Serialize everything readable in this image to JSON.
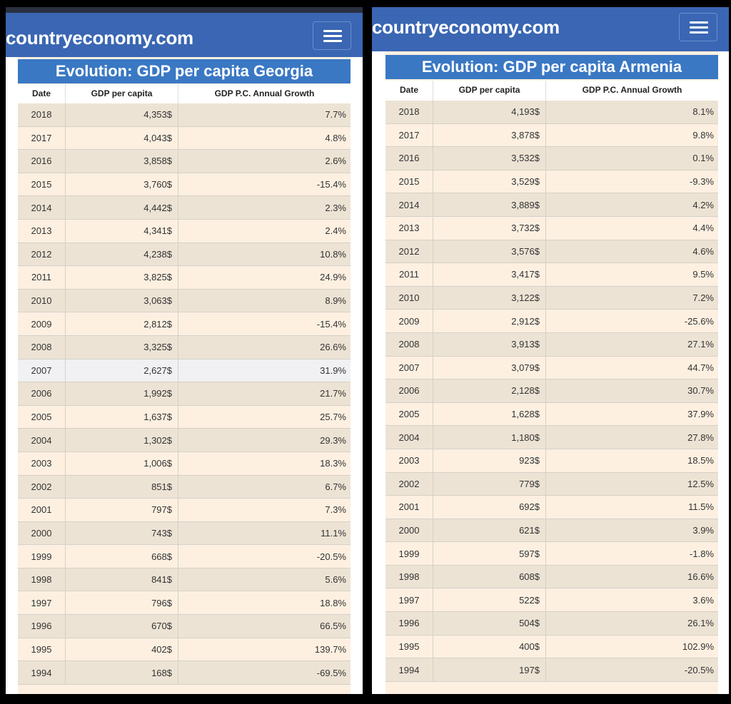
{
  "left": {
    "site_name": "countryeconomy.com",
    "table_title": "Evolution: GDP per capita Georgia",
    "headers": [
      "Date",
      "GDP per capita",
      "GDP P.C. Annual Growth"
    ],
    "rows": [
      [
        "2018",
        "4,353$",
        "7.7%"
      ],
      [
        "2017",
        "4,043$",
        "4.8%"
      ],
      [
        "2016",
        "3,858$",
        "2.6%"
      ],
      [
        "2015",
        "3,760$",
        "-15.4%"
      ],
      [
        "2014",
        "4,442$",
        "2.3%"
      ],
      [
        "2013",
        "4,341$",
        "2.4%"
      ],
      [
        "2012",
        "4,238$",
        "10.8%"
      ],
      [
        "2011",
        "3,825$",
        "24.9%"
      ],
      [
        "2010",
        "3,063$",
        "8.9%"
      ],
      [
        "2009",
        "2,812$",
        "-15.4%"
      ],
      [
        "2008",
        "3,325$",
        "26.6%"
      ],
      [
        "2007",
        "2,627$",
        "31.9%"
      ],
      [
        "2006",
        "1,992$",
        "21.7%"
      ],
      [
        "2005",
        "1,637$",
        "25.7%"
      ],
      [
        "2004",
        "1,302$",
        "29.3%"
      ],
      [
        "2003",
        "1,006$",
        "18.3%"
      ],
      [
        "2002",
        "851$",
        "6.7%"
      ],
      [
        "2001",
        "797$",
        "7.3%"
      ],
      [
        "2000",
        "743$",
        "11.1%"
      ],
      [
        "1999",
        "668$",
        "-20.5%"
      ],
      [
        "1998",
        "841$",
        "5.6%"
      ],
      [
        "1997",
        "796$",
        "18.8%"
      ],
      [
        "1996",
        "670$",
        "66.5%"
      ],
      [
        "1995",
        "402$",
        "139.7%"
      ],
      [
        "1994",
        "168$",
        "-69.5%"
      ]
    ]
  },
  "right": {
    "site_name": "countryeconomy.com",
    "table_title": "Evolution: GDP per capita Armenia",
    "headers": [
      "Date",
      "GDP per capita",
      "GDP P.C. Annual Growth"
    ],
    "rows": [
      [
        "2018",
        "4,193$",
        "8.1%"
      ],
      [
        "2017",
        "3,878$",
        "9.8%"
      ],
      [
        "2016",
        "3,532$",
        "0.1%"
      ],
      [
        "2015",
        "3,529$",
        "-9.3%"
      ],
      [
        "2014",
        "3,889$",
        "4.2%"
      ],
      [
        "2013",
        "3,732$",
        "4.4%"
      ],
      [
        "2012",
        "3,576$",
        "4.6%"
      ],
      [
        "2011",
        "3,417$",
        "9.5%"
      ],
      [
        "2010",
        "3,122$",
        "7.2%"
      ],
      [
        "2009",
        "2,912$",
        "-25.6%"
      ],
      [
        "2008",
        "3,913$",
        "27.1%"
      ],
      [
        "2007",
        "3,079$",
        "44.7%"
      ],
      [
        "2006",
        "2,128$",
        "30.7%"
      ],
      [
        "2005",
        "1,628$",
        "37.9%"
      ],
      [
        "2004",
        "1,180$",
        "27.8%"
      ],
      [
        "2003",
        "923$",
        "18.5%"
      ],
      [
        "2002",
        "779$",
        "12.5%"
      ],
      [
        "2001",
        "692$",
        "11.5%"
      ],
      [
        "2000",
        "621$",
        "3.9%"
      ],
      [
        "1999",
        "597$",
        "-1.8%"
      ],
      [
        "1998",
        "608$",
        "16.6%"
      ],
      [
        "1997",
        "522$",
        "3.6%"
      ],
      [
        "1996",
        "504$",
        "26.1%"
      ],
      [
        "1995",
        "400$",
        "102.9%"
      ],
      [
        "1994",
        "197$",
        "-20.5%"
      ]
    ]
  }
}
